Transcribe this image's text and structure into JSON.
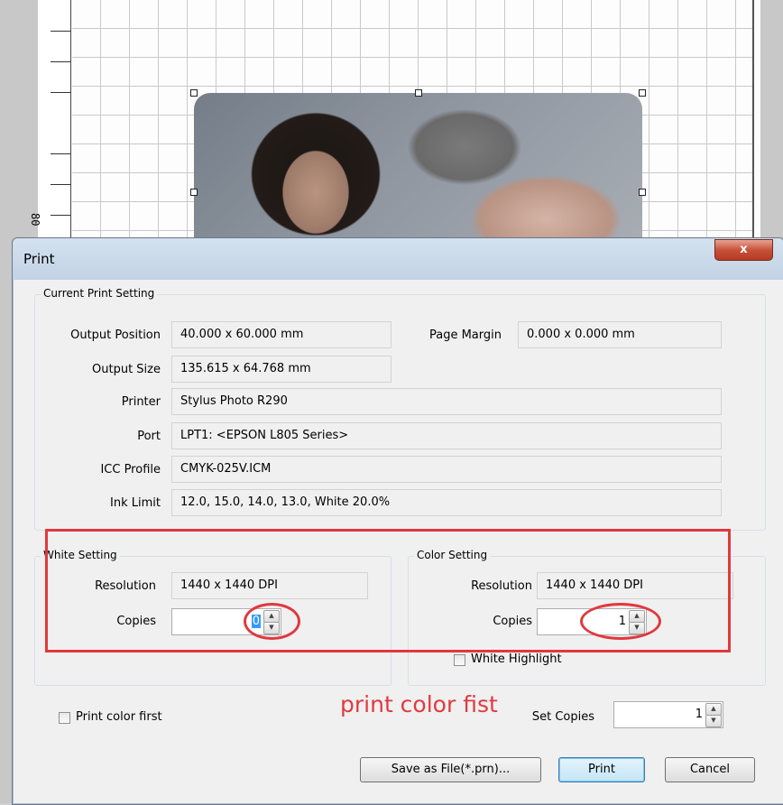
{
  "ruler": {
    "label": "80"
  },
  "dialog": {
    "title": "Print",
    "close_label": "x",
    "current": {
      "group_title": "Current Print Setting",
      "output_position": {
        "label": "Output Position",
        "value": "40.000 x 60.000 mm"
      },
      "page_margin": {
        "label": "Page Margin",
        "value": "0.000 x 0.000 mm"
      },
      "output_size": {
        "label": "Output Size",
        "value": "135.615 x 64.768 mm"
      },
      "printer": {
        "label": "Printer",
        "value": "Stylus Photo R290"
      },
      "port": {
        "label": "Port",
        "value": "LPT1:  <EPSON L805 Series>"
      },
      "icc_profile": {
        "label": "ICC Profile",
        "value": "CMYK-025V.ICM"
      },
      "ink_limit": {
        "label": "Ink Limit",
        "value": "12.0, 15.0, 14.0, 13.0, White 20.0%"
      }
    },
    "white": {
      "group_title": "White Setting",
      "resolution": {
        "label": "Resolution",
        "value": "1440 x 1440 DPI"
      },
      "copies": {
        "label": "Copies",
        "value": "0"
      }
    },
    "color": {
      "group_title": "Color Setting",
      "resolution": {
        "label": "Resolution",
        "value": "1440 x 1440 DPI"
      },
      "copies": {
        "label": "Copies",
        "value": "1"
      },
      "white_highlight": "White Highlight"
    },
    "print_color_first": "Print color first",
    "annotation": "print color fist",
    "set_copies": {
      "label": "Set Copies",
      "value": "1"
    },
    "buttons": {
      "save": "Save as File(*.prn)...",
      "print": "Print",
      "cancel": "Cancel"
    }
  },
  "colors": {
    "annotation_red": "#e0393e",
    "selection_blue": "#3399ff"
  }
}
